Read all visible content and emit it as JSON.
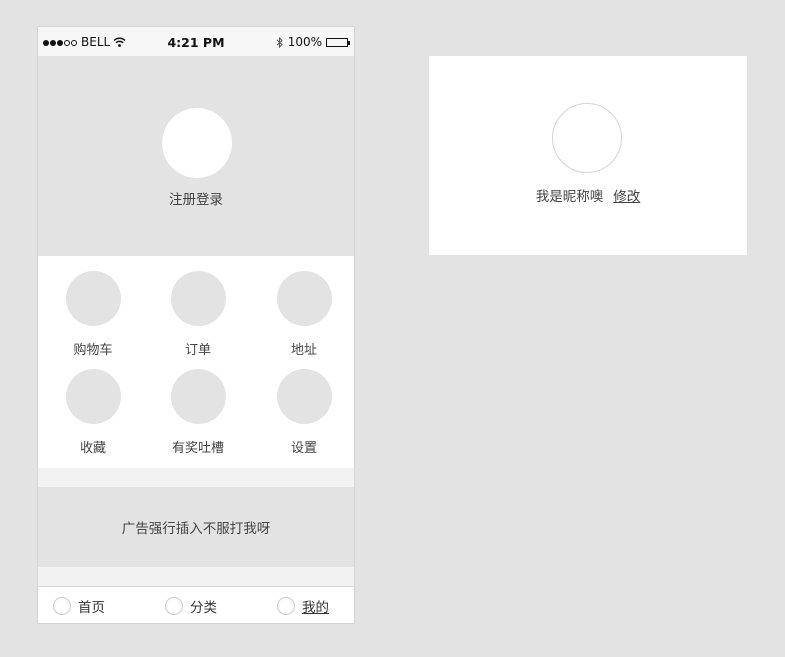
{
  "status_bar": {
    "carrier": "BELL",
    "time": "4:21 PM",
    "battery": "100%",
    "signal_bars_filled": 3,
    "signal_bars_total": 5
  },
  "header": {
    "login_label": "注册登录"
  },
  "grid": {
    "items": [
      {
        "label": "购物车",
        "icon": "cart-icon"
      },
      {
        "label": "订单",
        "icon": "order-icon"
      },
      {
        "label": "地址",
        "icon": "address-icon"
      },
      {
        "label": "收藏",
        "icon": "favorite-icon"
      },
      {
        "label": "有奖吐槽",
        "icon": "feedback-icon"
      },
      {
        "label": "设置",
        "icon": "settings-icon"
      }
    ]
  },
  "ad": {
    "text": "广告强行插入不服打我呀"
  },
  "tab_bar": {
    "tabs": [
      {
        "label": "首页"
      },
      {
        "label": "分类"
      },
      {
        "label": "我的",
        "active": true
      }
    ]
  },
  "profile_card": {
    "nickname": "我是昵称噢",
    "edit_label": "修改"
  },
  "colors": {
    "background": "#e3e3e3",
    "panel": "#ffffff",
    "placeholder": "#e3e3e3"
  }
}
